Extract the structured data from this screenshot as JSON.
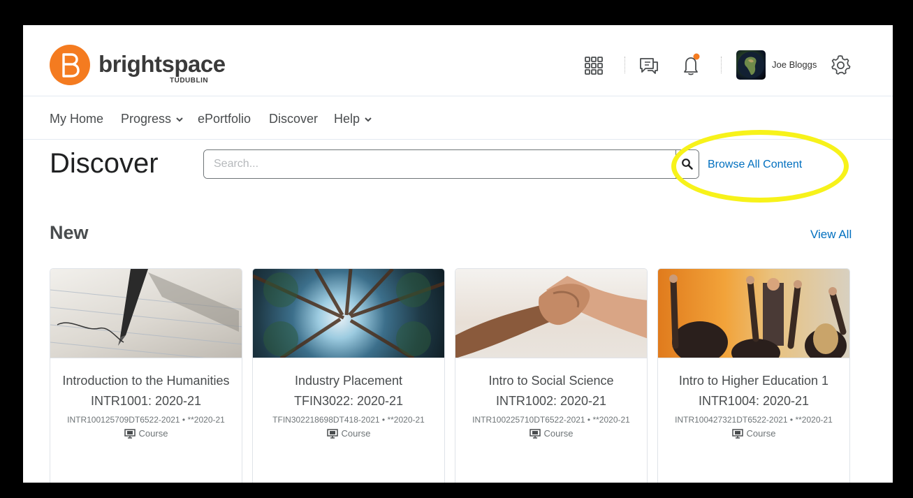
{
  "brand": {
    "name": "brightspace",
    "sub": "TUDUBLIN",
    "mark": "B",
    "color": "#f47b20"
  },
  "header": {
    "user_name": "Joe Bloggs",
    "icons": [
      "apps-grid-icon",
      "messages-icon",
      "notifications-icon",
      "settings-icon"
    ],
    "notification_dot_color": "#f47b20"
  },
  "nav": {
    "items": [
      {
        "label": "My Home",
        "dropdown": false
      },
      {
        "label": "Progress",
        "dropdown": true
      },
      {
        "label": "ePortfolio",
        "dropdown": false
      },
      {
        "label": "Discover",
        "dropdown": false
      },
      {
        "label": "Help",
        "dropdown": true
      }
    ]
  },
  "discover": {
    "title": "Discover",
    "search_placeholder": "Search...",
    "search_value": "",
    "browse_label": "Browse All Content",
    "link_color": "#006fbf",
    "highlight_color": "#f7f21a"
  },
  "new_section": {
    "title": "New",
    "view_all_label": "View All",
    "cards": [
      {
        "title": "Introduction to the Humanities INTR1001: 2020-21",
        "code": "INTR100125709DT6522-2021 • **2020-21",
        "type": "Course",
        "image": "pen-writing-image"
      },
      {
        "title": "Industry Placement TFIN3022: 2020-21",
        "code": "TFIN302218698DT418-2021 • **2020-21",
        "type": "Course",
        "image": "forest-canopy-image"
      },
      {
        "title": "Intro to Social Science INTR1002: 2020-21",
        "code": "INTR100225710DT6522-2021 • **2020-21",
        "type": "Course",
        "image": "holding-hands-image"
      },
      {
        "title": "Intro to Higher Education 1 INTR1004: 2020-21",
        "code": "INTR100427321DT6522-2021 • **2020-21",
        "type": "Course",
        "image": "raised-hands-classroom-image"
      }
    ]
  }
}
